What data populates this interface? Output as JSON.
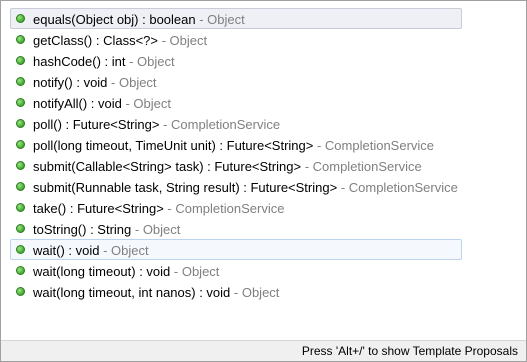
{
  "proposals": [
    {
      "signature": "equals(Object obj) : boolean",
      "owner": " - Object",
      "state": "selected"
    },
    {
      "signature": "getClass() : Class<?>",
      "owner": " - Object",
      "state": ""
    },
    {
      "signature": "hashCode() : int",
      "owner": " - Object",
      "state": ""
    },
    {
      "signature": "notify() : void",
      "owner": " - Object",
      "state": ""
    },
    {
      "signature": "notifyAll() : void",
      "owner": " - Object",
      "state": ""
    },
    {
      "signature": "poll() : Future<String>",
      "owner": " - CompletionService",
      "state": ""
    },
    {
      "signature": "poll(long timeout, TimeUnit unit) : Future<String>",
      "owner": " - CompletionService",
      "state": ""
    },
    {
      "signature": "submit(Callable<String> task) : Future<String>",
      "owner": " - CompletionService",
      "state": ""
    },
    {
      "signature": "submit(Runnable task, String result) : Future<String>",
      "owner": " - CompletionService",
      "state": ""
    },
    {
      "signature": "take() : Future<String>",
      "owner": " - CompletionService",
      "state": ""
    },
    {
      "signature": "toString() : String",
      "owner": " - Object",
      "state": ""
    },
    {
      "signature": "wait() : void",
      "owner": " - Object",
      "state": "hover"
    },
    {
      "signature": "wait(long timeout) : void",
      "owner": " - Object",
      "state": ""
    },
    {
      "signature": "wait(long timeout, int nanos) : void",
      "owner": " - Object",
      "state": ""
    }
  ],
  "method_icon": "public-method-icon",
  "colors": {
    "owner_text": "#808080",
    "method_icon": "#4fb83a"
  },
  "status_bar": {
    "hint": "Press 'Alt+/' to show Template Proposals"
  }
}
